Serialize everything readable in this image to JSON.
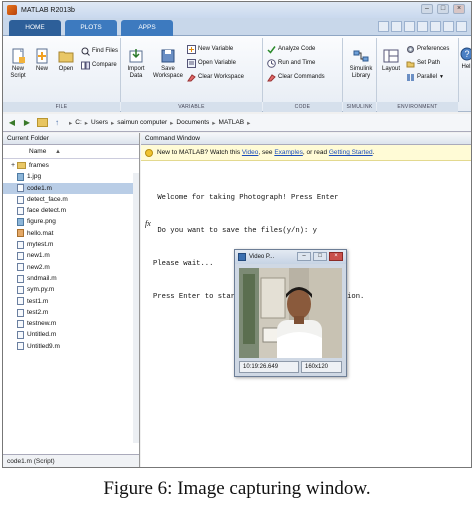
{
  "window": {
    "title": "MATLAB R2013b"
  },
  "tabs": {
    "home": "HOME",
    "plots": "PLOTS",
    "apps": "APPS"
  },
  "ribbon": {
    "file": {
      "label": "FILE",
      "new_script": [
        "New",
        "Script"
      ],
      "new": [
        "New",
        ""
      ],
      "open": [
        "Open",
        ""
      ],
      "find_files": "Find Files",
      "compare": "Compare"
    },
    "variable": {
      "label": "VARIABLE",
      "import": [
        "Import",
        "Data"
      ],
      "save": [
        "Save",
        "Workspace"
      ],
      "new_variable": "New Variable",
      "open_variable": "Open Variable",
      "clear_workspace": "Clear Workspace"
    },
    "code": {
      "label": "CODE",
      "analyze": "Analyze Code",
      "run_time": "Run and Time",
      "clear_commands": "Clear Commands"
    },
    "simulink": {
      "label": "SIMULINK",
      "library": [
        "Simulink",
        "Library"
      ]
    },
    "environment": {
      "label": "ENVIRONMENT",
      "layout": "Layout",
      "preferences": "Preferences",
      "set_path": "Set Path",
      "parallel": "Parallel",
      "help": "Hel"
    }
  },
  "address": {
    "crumbs": [
      "C:",
      "Users",
      "saimun computer",
      "Documents",
      "MATLAB"
    ]
  },
  "current_folder": {
    "header": "Current Folder",
    "column": "Name",
    "sort_arrow": "▲",
    "files": [
      {
        "name": "frames",
        "type": "folder"
      },
      {
        "name": "1.jpg",
        "type": "img"
      },
      {
        "name": "code1.m",
        "type": "m",
        "selected": true
      },
      {
        "name": "detect_face.m",
        "type": "m"
      },
      {
        "name": "face detect.m",
        "type": "m"
      },
      {
        "name": "figure.png",
        "type": "img"
      },
      {
        "name": "hello.mat",
        "type": "mat"
      },
      {
        "name": "mytest.m",
        "type": "m"
      },
      {
        "name": "new1.m",
        "type": "m"
      },
      {
        "name": "new2.m",
        "type": "m"
      },
      {
        "name": "sndmail.m",
        "type": "m"
      },
      {
        "name": "sym.py.m",
        "type": "m"
      },
      {
        "name": "test1.m",
        "type": "m"
      },
      {
        "name": "test2.m",
        "type": "m"
      },
      {
        "name": "testnew.m",
        "type": "m"
      },
      {
        "name": "Untitled.m",
        "type": "m"
      },
      {
        "name": "Untitled9.m",
        "type": "m"
      }
    ],
    "footer": "code1.m (Script)"
  },
  "command_window": {
    "header": "Command Window",
    "notice": {
      "prefix": "New to MATLAB? Watch this ",
      "link1": "Video",
      "mid1": ", see ",
      "link2": "Examples",
      "mid2": ", or read ",
      "link3": "Getting Started",
      "suffix": "."
    },
    "lines": [
      " Welcome for taking Photograph! Press Enter",
      " Do you want to save the files(y/n): y",
      "Please wait...",
      "Press Enter to start after webcam initialization."
    ],
    "prompt": "fx"
  },
  "video_window": {
    "title": "Video P...",
    "timestamp": "10:19:26.649",
    "resolution": "160x120"
  },
  "caption": "Figure 6: Image capturing window."
}
